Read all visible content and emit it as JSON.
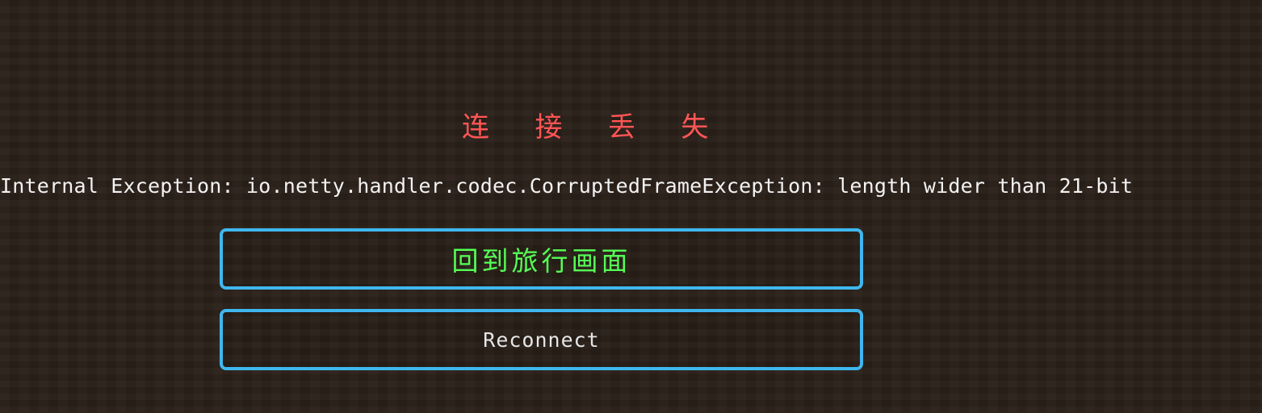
{
  "screen": {
    "title": "连 接 丢 失",
    "reason": "Internal Exception: io.netty.handler.codec.CorruptedFrameException: length wider than 21-bit"
  },
  "buttons": {
    "back_label": "回到旅行画面",
    "reconnect_label": "Reconnect"
  },
  "colors": {
    "background": "#2a2019",
    "title": "#ff5555",
    "reason_text": "#f2f2f2",
    "button_border": "#3fb7ee",
    "primary_button_text": "#55ff55",
    "secondary_button_text": "#e6e6e6"
  }
}
